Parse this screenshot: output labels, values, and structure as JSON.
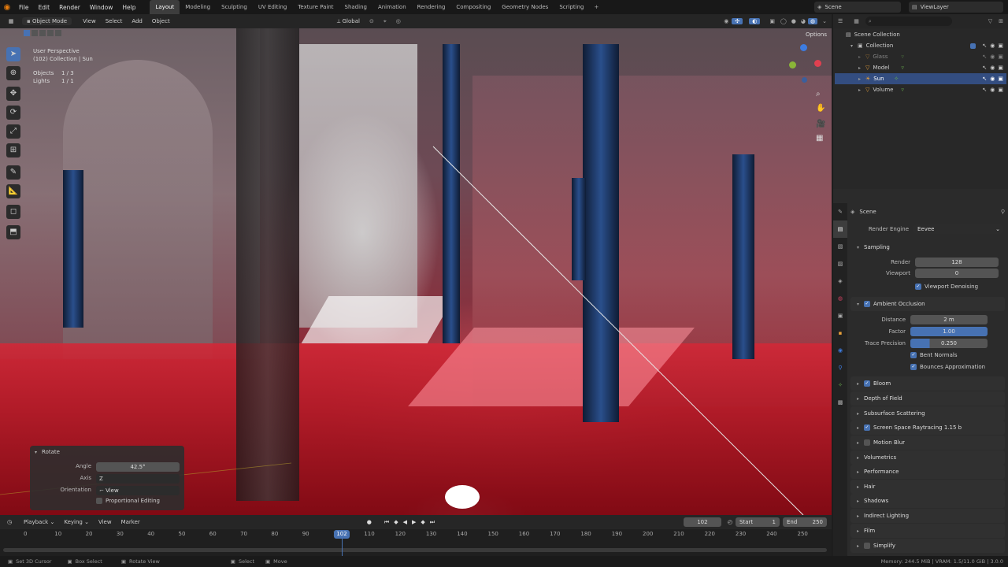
{
  "menu": [
    "File",
    "Edit",
    "Render",
    "Window",
    "Help"
  ],
  "workspaces": [
    "Layout",
    "Modeling",
    "Sculpting",
    "UV Editing",
    "Texture Paint",
    "Shading",
    "Animation",
    "Rendering",
    "Compositing",
    "Geometry Nodes",
    "Scripting"
  ],
  "active_workspace": "Layout",
  "scene_name": "Scene",
  "view_layer": "ViewLayer",
  "viewport_header": {
    "mode": "Object Mode",
    "menus": [
      "View",
      "Select",
      "Add",
      "Object"
    ],
    "orientation": "Global",
    "options": "Options"
  },
  "overlay_info": {
    "perspective": "User Perspective",
    "collection": "(102) Collection | Sun",
    "objects_label": "Objects",
    "objects_value": "1 / 3",
    "lights_label": "Lights",
    "lights_value": "1 / 1"
  },
  "tools": [
    "cursor-select",
    "cursor-3d",
    "move",
    "rotate",
    "scale",
    "transform",
    "annotate",
    "measure",
    "add-cube",
    "extrude"
  ],
  "operator_panel": {
    "title": "Rotate",
    "angle_label": "Angle",
    "angle_value": "42.5°",
    "axis_label": "Axis",
    "axis_value": "Z",
    "orientation_label": "Orientation",
    "orientation_value": "View",
    "proportional": "Proportional Editing"
  },
  "outliner": {
    "root": "Scene Collection",
    "collection": "Collection",
    "items": [
      "Glass",
      "Model",
      "Sun",
      "Volume"
    ],
    "selected": "Sun"
  },
  "properties": {
    "context": "Scene",
    "render_engine_label": "Render Engine",
    "render_engine": "Eevee",
    "sampling": {
      "title": "Sampling",
      "render_label": "Render",
      "render_value": "128",
      "viewport_label": "Viewport",
      "viewport_value": "0",
      "denoise": "Viewport Denoising"
    },
    "ao": {
      "title": "Ambient Occlusion",
      "distance_label": "Distance",
      "distance_value": "2 m",
      "factor_label": "Factor",
      "factor_value": "1.00",
      "trace_label": "Trace Precision",
      "trace_value": "0.250",
      "bent": "Bent Normals",
      "bounces": "Bounces Approximation"
    },
    "sections": [
      "Bloom",
      "Depth of Field",
      "Subsurface Scattering",
      "Screen Space Raytracing 1.15 b",
      "Motion Blur",
      "Volumetrics",
      "Performance",
      "Hair",
      "Shadows",
      "Indirect Lighting",
      "Film",
      "Simplify"
    ]
  },
  "timeline": {
    "menus": [
      "Playback",
      "Keying",
      "View",
      "Marker"
    ],
    "current_frame": "102",
    "start_label": "Start",
    "start_value": "1",
    "end_label": "End",
    "end_value": "250",
    "ticks": [
      "0",
      "10",
      "20",
      "30",
      "40",
      "50",
      "60",
      "70",
      "80",
      "90",
      "100",
      "110",
      "120",
      "130",
      "140",
      "150",
      "160",
      "170",
      "180",
      "190",
      "200",
      "210",
      "220",
      "230",
      "240",
      "250"
    ],
    "playhead": "102"
  },
  "status": {
    "left": [
      "Set 3D Cursor",
      "Box Select",
      "Rotate View",
      "Select",
      "Move"
    ],
    "right": "Memory: 244.5 MiB | VRAM: 1.5/11.0 GiB | 3.0.0"
  },
  "colors": {
    "accent": "#4772b3",
    "selected_row": "#334d80"
  }
}
